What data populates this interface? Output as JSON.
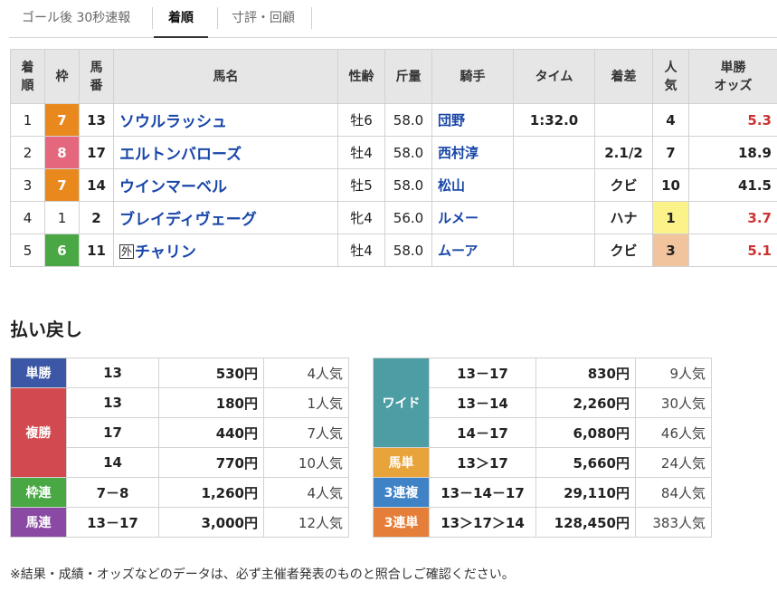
{
  "tabs": [
    {
      "label": "ゴール後 30秒速報"
    },
    {
      "label": "着順"
    },
    {
      "label": "寸評・回顧"
    }
  ],
  "results": {
    "headers": {
      "rank": "着\n順",
      "waku": "枠",
      "number": "馬\n番",
      "name": "馬名",
      "sexage": "性齢",
      "weight": "斤量",
      "jockey": "騎手",
      "time": "タイム",
      "margin": "着差",
      "popularity": "人\n気",
      "odds": "単勝\nオッズ"
    },
    "rows": [
      {
        "rank": "1",
        "waku": "7",
        "number": "13",
        "foreign": "",
        "name": "ソウルラッシュ",
        "sexage": "牡6",
        "weight": "58.0",
        "jockey": "団野",
        "time": "1:32.0",
        "margin": "",
        "popularity": "4",
        "odds": "5.3"
      },
      {
        "rank": "2",
        "waku": "8",
        "number": "17",
        "foreign": "",
        "name": "エルトンバローズ",
        "sexage": "牡4",
        "weight": "58.0",
        "jockey": "西村淳",
        "time": "",
        "margin": "2.1/2",
        "popularity": "7",
        "odds": "18.9"
      },
      {
        "rank": "3",
        "waku": "7",
        "number": "14",
        "foreign": "",
        "name": "ウインマーベル",
        "sexage": "牡5",
        "weight": "58.0",
        "jockey": "松山",
        "time": "",
        "margin": "クビ",
        "popularity": "10",
        "odds": "41.5"
      },
      {
        "rank": "4",
        "waku": "1",
        "number": "2",
        "foreign": "",
        "name": "ブレイディヴェーグ",
        "sexage": "牝4",
        "weight": "56.0",
        "jockey": "ルメー",
        "time": "",
        "margin": "ハナ",
        "popularity": "1",
        "odds": "3.7"
      },
      {
        "rank": "5",
        "waku": "6",
        "number": "11",
        "foreign": "外",
        "name": "チャリン",
        "sexage": "牡4",
        "weight": "58.0",
        "jockey": "ムーア",
        "time": "",
        "margin": "クビ",
        "popularity": "3",
        "odds": "5.1"
      }
    ]
  },
  "payout": {
    "title": "払い戻し",
    "left": {
      "tansho": {
        "label": "単勝",
        "entries": [
          {
            "combo": "13",
            "amount": "530円",
            "pop": "4人気"
          }
        ]
      },
      "fukusho": {
        "label": "複勝",
        "entries": [
          {
            "combo": "13",
            "amount": "180円",
            "pop": "1人気"
          },
          {
            "combo": "17",
            "amount": "440円",
            "pop": "7人気"
          },
          {
            "combo": "14",
            "amount": "770円",
            "pop": "10人気"
          }
        ]
      },
      "wakuren": {
        "label": "枠連",
        "entries": [
          {
            "combo": "7－8",
            "amount": "1,260円",
            "pop": "4人気"
          }
        ]
      },
      "umaren": {
        "label": "馬連",
        "entries": [
          {
            "combo": "13－17",
            "amount": "3,000円",
            "pop": "12人気"
          }
        ]
      }
    },
    "right": {
      "wide": {
        "label": "ワイド",
        "entries": [
          {
            "combo": "13－17",
            "amount": "830円",
            "pop": "9人気"
          },
          {
            "combo": "13－14",
            "amount": "2,260円",
            "pop": "30人気"
          },
          {
            "combo": "14－17",
            "amount": "6,080円",
            "pop": "46人気"
          }
        ]
      },
      "umatan": {
        "label": "馬単",
        "entries": [
          {
            "combo": "13＞17",
            "amount": "5,660円",
            "pop": "24人気"
          }
        ]
      },
      "sanrenpuku": {
        "label": "3連複",
        "entries": [
          {
            "combo": "13－14－17",
            "amount": "29,110円",
            "pop": "84人気"
          }
        ]
      },
      "sanrentan": {
        "label": "3連単",
        "entries": [
          {
            "combo": "13＞17＞14",
            "amount": "128,450円",
            "pop": "383人気"
          }
        ]
      }
    }
  },
  "note": "※結果・成績・オッズなどのデータは、必ず主催者発表のものと照合しご確認ください。",
  "colors": {
    "waku_7": "#e9891d",
    "waku_8": "#e4677d",
    "waku_6": "#4aa844",
    "horse_name": "#1846a8",
    "odds_hot": "#cc3333",
    "popularity_1": "#fbf38a",
    "popularity_3": "#f2c49e"
  }
}
